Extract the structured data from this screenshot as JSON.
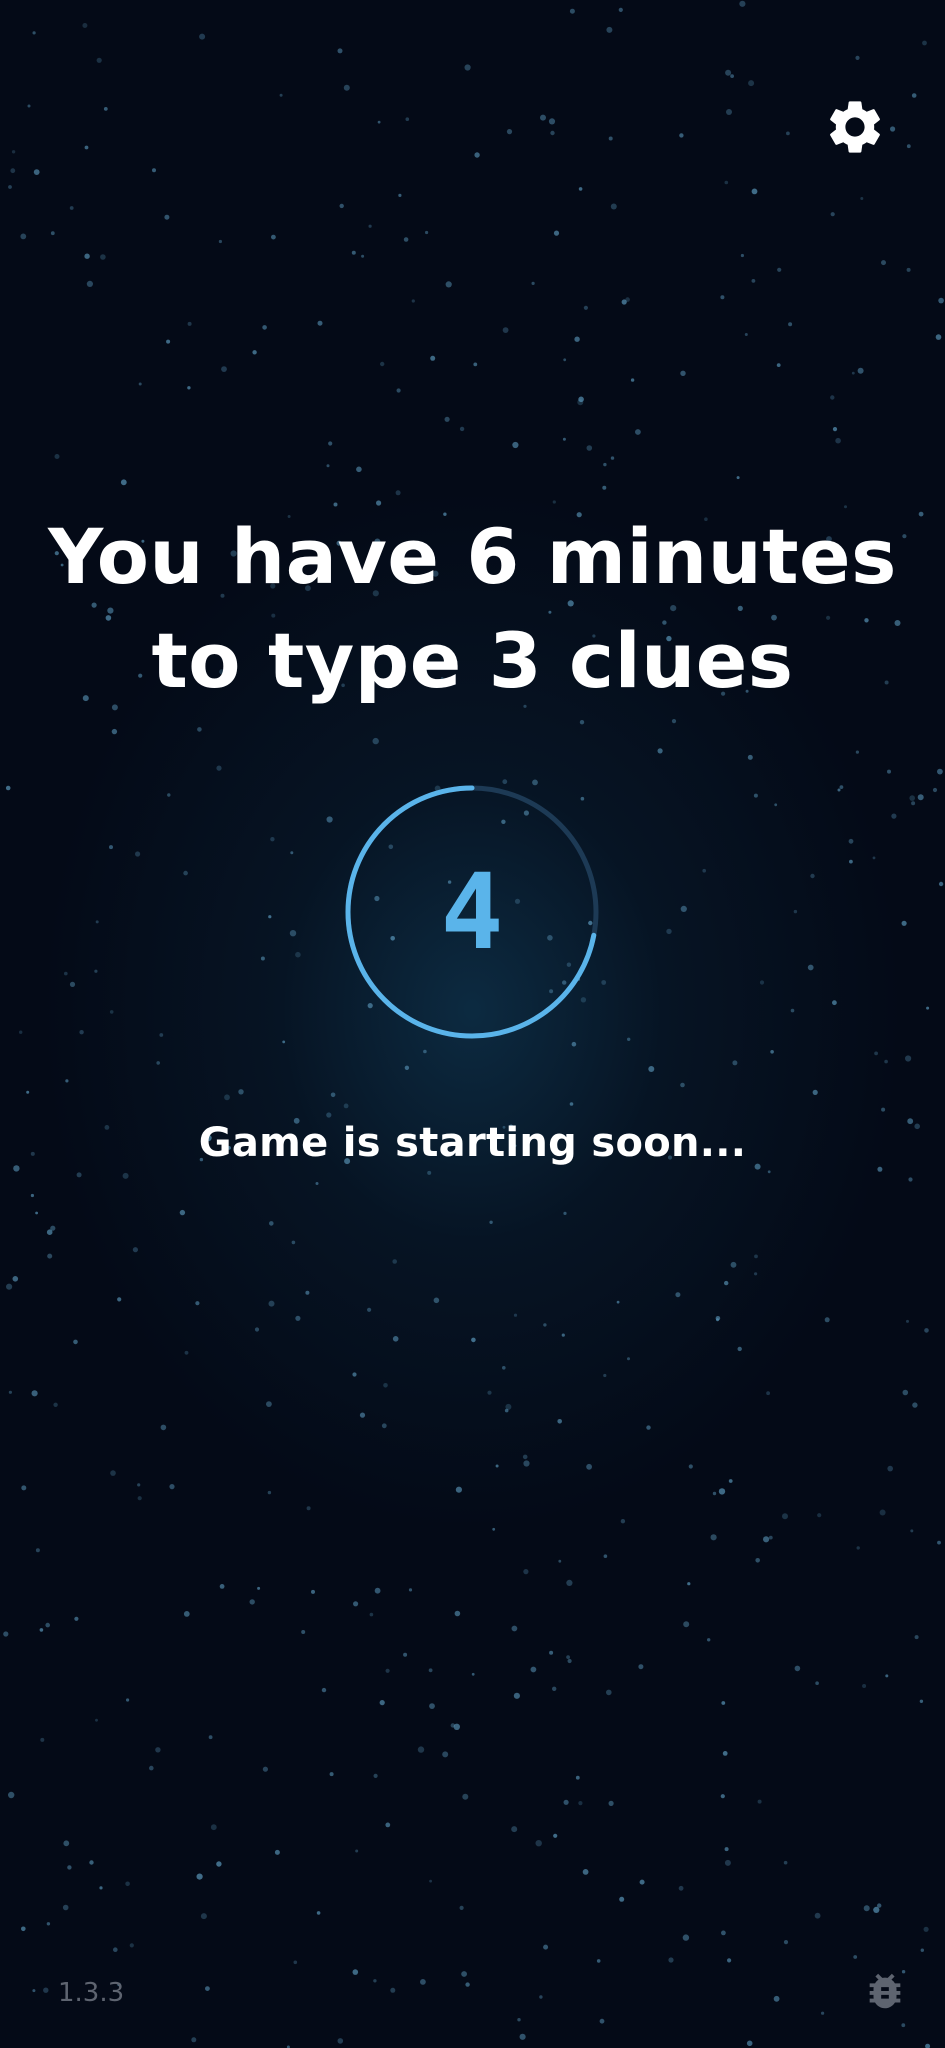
{
  "headline": {
    "line1": "You have 6 minutes",
    "line2": "to type 3 clues"
  },
  "countdown": {
    "value": "4",
    "progress_fraction": 0.72
  },
  "status": {
    "text": "Game is starting soon..."
  },
  "footer": {
    "version": "1.3.3"
  },
  "icons": {
    "settings": "gear-icon",
    "bug_report": "bug-icon"
  },
  "colors": {
    "background": "#040a17",
    "accent": "#5ab4ea",
    "ring_track": "#1d3a55",
    "text": "#ffffff",
    "muted": "#5e6470"
  }
}
